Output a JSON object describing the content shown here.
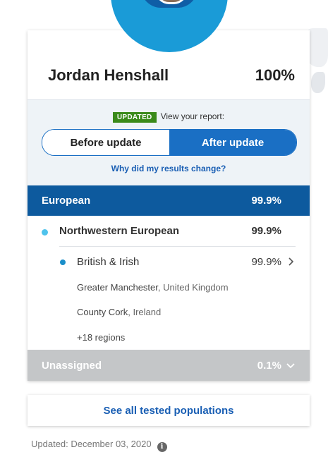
{
  "profile": {
    "name": "Jordan Henshall",
    "percent": "100%"
  },
  "update": {
    "badge": "UPDATED",
    "prompt": "View your report:",
    "before_label": "Before update",
    "after_label": "After update",
    "why_link": "Why did my results change?"
  },
  "regions": {
    "european": {
      "label": "European",
      "value": "99.9%"
    },
    "northwestern": {
      "label": "Northwestern European",
      "value": "99.9%"
    },
    "british_irish": {
      "label": "British & Irish",
      "value": "99.9%",
      "subregions": [
        {
          "place": "Greater Manchester",
          "country": ", United Kingdom"
        },
        {
          "place": "County Cork",
          "country": ", Ireland"
        }
      ],
      "more": "+18 regions"
    },
    "unassigned": {
      "label": "Unassigned",
      "value": "0.1%"
    }
  },
  "see_all": "See all tested populations",
  "footer": {
    "updated": "Updated: December 03, 2020"
  },
  "colors": {
    "european_bar": "#0d5a9e",
    "toggle_active": "#1a6fc4",
    "northwestern_dot": "#4fc3ec",
    "british_dot": "#1a8ec9",
    "unassigned_bar": "#c4c6c8",
    "badge": "#3a8a1a"
  },
  "icons": {
    "chevron_right": "chevron-right-icon",
    "chevron_down": "chevron-down-icon",
    "info": "info-icon"
  }
}
